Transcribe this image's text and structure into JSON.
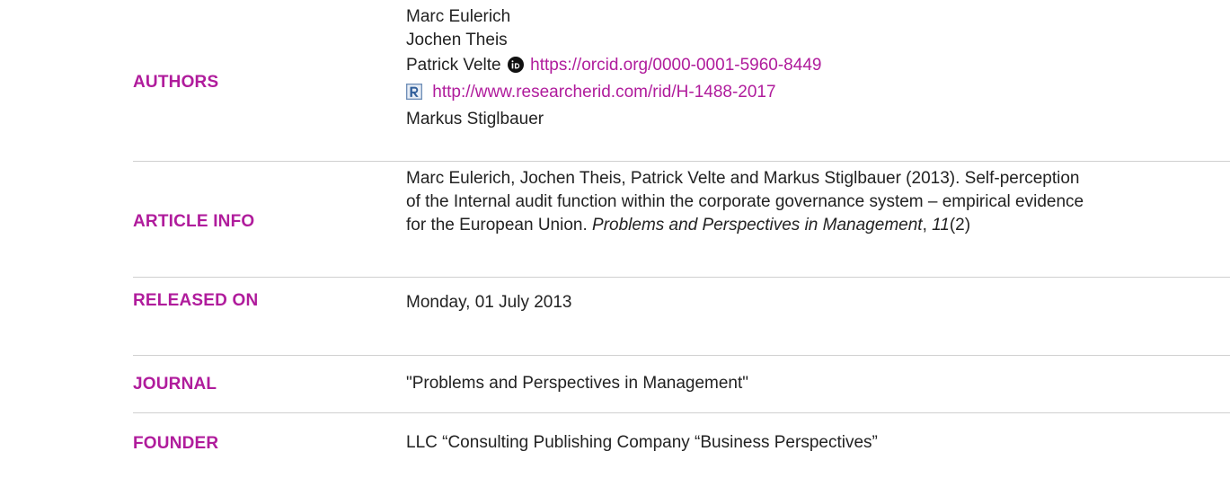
{
  "rows": {
    "authors": {
      "label": "AUTHORS",
      "names": [
        "Marc Eulerich",
        "Jochen Theis",
        "Patrick Velte",
        "Markus Stiglbauer"
      ],
      "orcid_icon": "orcid-icon",
      "orcid_url": "https://orcid.org/0000-0001-5960-8449",
      "rid_icon": "researcherid-icon",
      "rid_url": "http://www.researcherid.com/rid/H-1488-2017"
    },
    "article_info": {
      "label": "ARTICLE INFO",
      "citation_main": "Marc Eulerich, Jochen Theis, Patrick Velte and Markus Stiglbauer (2013). Self-perception of the Internal audit function within the corporate governance system – empirical evidence for the European Union. ",
      "citation_journal": "Problems and Perspectives in Management",
      "citation_sep": ", ",
      "citation_volume": "11",
      "citation_issue": "(2)"
    },
    "released_on": {
      "label": "RELEASED ON",
      "value": "Monday, 01 July 2013"
    },
    "journal": {
      "label": "JOURNAL",
      "value": "\"Problems and Perspectives in Management\""
    },
    "founder": {
      "label": "FOUNDER",
      "value": "LLC “Consulting Publishing Company “Business Perspectives”"
    }
  },
  "colors": {
    "label": "#b01c9c",
    "link": "#b01c9c",
    "text": "#222222",
    "divider": "#d0d0d0"
  }
}
